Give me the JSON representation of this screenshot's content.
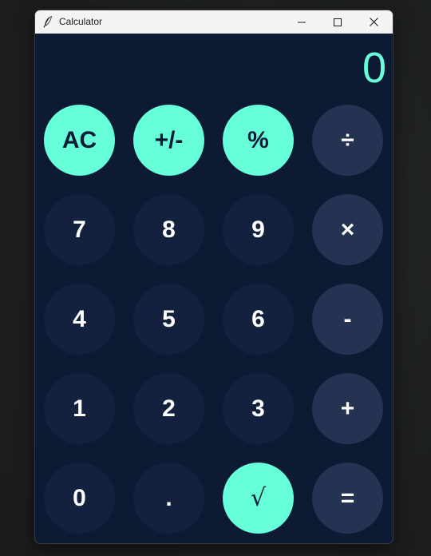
{
  "window": {
    "title": "Calculator"
  },
  "display": {
    "value": "0"
  },
  "colors": {
    "accent": "#66ffd9",
    "background": "#0c1a33",
    "number_key": "#13213f",
    "operator_key": "#233351"
  },
  "keys": {
    "ac": "AC",
    "plus_minus": "+/-",
    "percent": "%",
    "divide": "÷",
    "seven": "7",
    "eight": "8",
    "nine": "9",
    "multiply": "×",
    "four": "4",
    "five": "5",
    "six": "6",
    "subtract": "-",
    "one": "1",
    "two": "2",
    "three": "3",
    "add": "+",
    "zero": "0",
    "decimal": ".",
    "sqrt": "√",
    "equals": "="
  }
}
